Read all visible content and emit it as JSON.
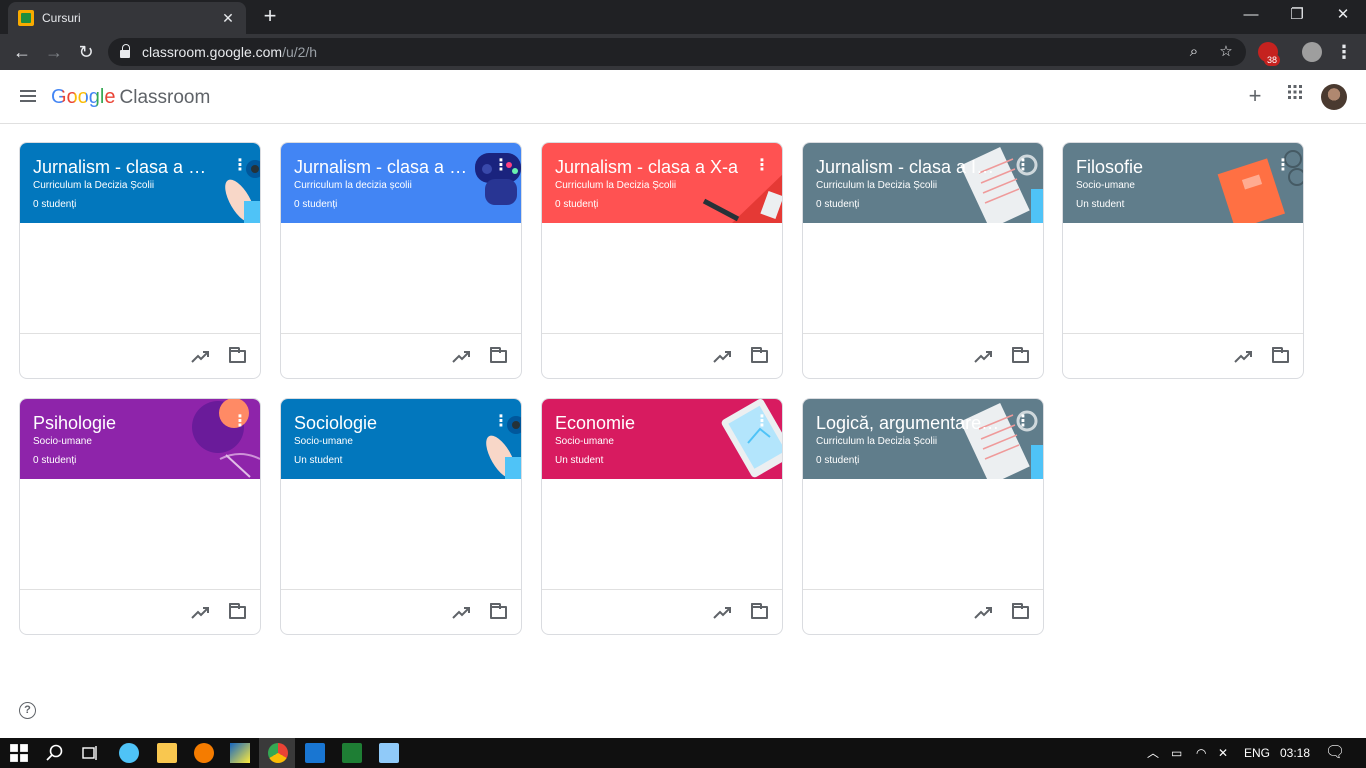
{
  "browser": {
    "tab_title": "Cursuri",
    "url_host": "classroom.google.com",
    "url_path": "/u/2/h",
    "extension_badge": "38"
  },
  "app": {
    "brand": "Google",
    "product": "Classroom"
  },
  "courses": [
    {
      "name": "Jurnalism - clasa a XII-a",
      "section": "Curriculum la Decizia Școlii",
      "students": "0 studenți",
      "color": "#0277bd",
      "theme": "feather-robot"
    },
    {
      "name": "Jurnalism - clasa a XI-a",
      "section": "Curriculum la decizia școlii",
      "students": "0 studenți",
      "color": "#4285f4",
      "theme": "gamepad"
    },
    {
      "name": "Jurnalism - clasa a X-a",
      "section": "Curriculum la Decizia Școlii",
      "students": "0 studenți",
      "color": "#ff5252",
      "theme": "cooking"
    },
    {
      "name": "Jurnalism - clasa a IX-a",
      "section": "Curriculum la Decizia Școlii",
      "students": "0 studenți",
      "color": "#607d8b",
      "theme": "notepad"
    },
    {
      "name": "Filosofie",
      "section": "Socio-umane",
      "students": "Un student",
      "color": "#607d8b",
      "theme": "book"
    },
    {
      "name": "Psihologie",
      "section": "Socio-umane",
      "students": "0 studenți",
      "color": "#8e24aa",
      "theme": "yarn"
    },
    {
      "name": "Sociologie",
      "section": "Socio-umane",
      "students": "Un student",
      "color": "#0277bd",
      "theme": "feather-robot"
    },
    {
      "name": "Economie",
      "section": "Socio-umane",
      "students": "Un student",
      "color": "#d81b60",
      "theme": "tablet"
    },
    {
      "name": "Logică, argumentare și comunicare",
      "section": "Curriculum la Decizia Școlii",
      "students": "0 studenți",
      "color": "#607d8b",
      "theme": "notepad"
    }
  ],
  "icons": {
    "trend": "trending-up-icon",
    "folder": "folder-icon",
    "help": "help-icon",
    "more": "more-vert-icon"
  },
  "taskbar": {
    "language": "ENG",
    "time": "03:18"
  }
}
